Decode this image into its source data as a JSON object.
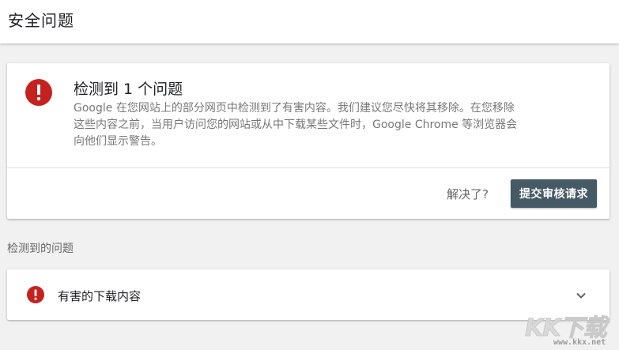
{
  "header": {
    "title": "安全问题"
  },
  "issue_card": {
    "icon": "error-icon",
    "title": "检测到 1 个问题",
    "description": "Google 在您网站上的部分网页中检测到了有害内容。我们建议您尽快将其移除。在您移除这些内容之前，当用户访问您的网站或从中下载某些文件时，Google Chrome 等浏览器会向他们显示警告。",
    "resolved_text": "解决了?",
    "submit_label": "提交审核请求"
  },
  "detected": {
    "section_label": "检测到的问题",
    "items": [
      {
        "label": "有害的下载内容",
        "icon": "error-icon",
        "expand_icon": "chevron-down-icon"
      }
    ]
  },
  "watermark": {
    "logo": "KK下载",
    "url": "www.kkx.net"
  },
  "colors": {
    "error_red": "#c5221f",
    "button_bg": "#455a64",
    "page_bg": "#f1f1f1"
  }
}
